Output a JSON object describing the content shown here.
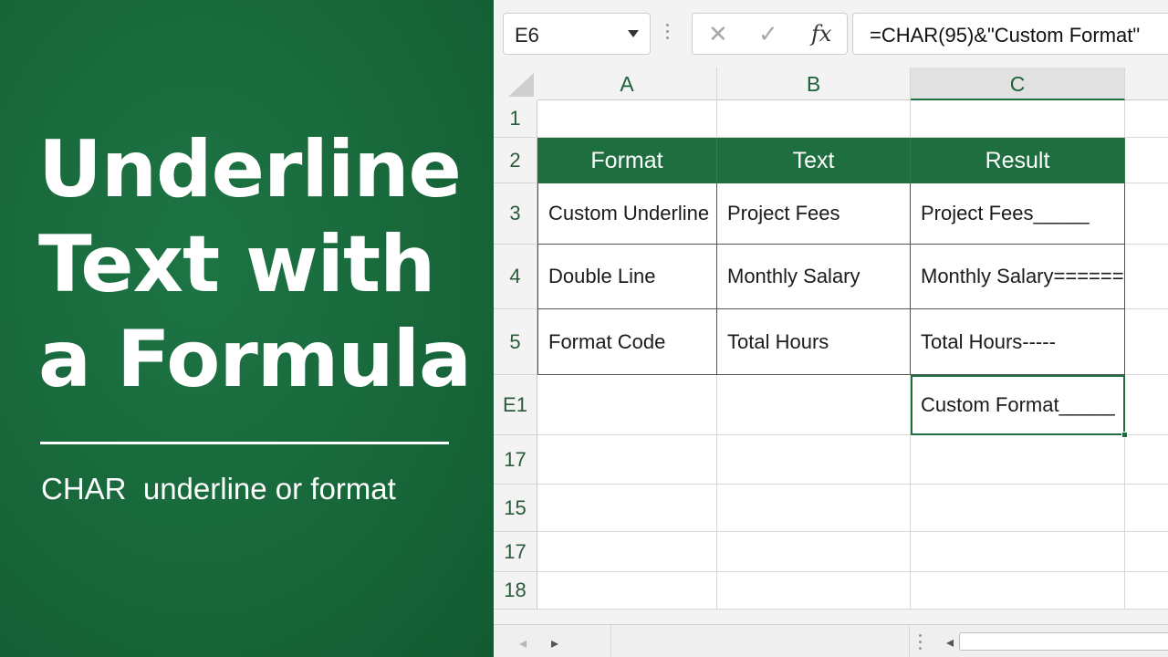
{
  "thumbnail": {
    "headline": [
      "Underline",
      "Text with",
      "a Formula"
    ],
    "subtitle": "CHAR  underline or format"
  },
  "formula_bar": {
    "name_box": "E6",
    "cancel_icon": "✕",
    "enter_icon": "✓",
    "fx_label": "fx",
    "formula": "=CHAR(95)&\"Custom Format\""
  },
  "columns": [
    "A",
    "B",
    "C"
  ],
  "active_column": "C",
  "rows": [
    {
      "label": "1",
      "cells": [
        "",
        "",
        ""
      ]
    },
    {
      "label": "2",
      "cells": [
        "Format",
        "Text",
        "Result"
      ]
    },
    {
      "label": "3",
      "cells": [
        "Custom Underline",
        "Project Fees",
        "Project Fees_____"
      ]
    },
    {
      "label": "4",
      "cells": [
        "Double Line",
        "Monthly Salary",
        "Monthly Salary======="
      ]
    },
    {
      "label": "5",
      "cells": [
        "Format Code",
        "Total Hours",
        "Total Hours-----"
      ]
    },
    {
      "label": "E1",
      "cells": [
        "",
        "",
        "Custom Format_____"
      ]
    },
    {
      "label": "17",
      "cells": [
        "",
        "",
        ""
      ]
    },
    {
      "label": "15",
      "cells": [
        "",
        "",
        ""
      ]
    },
    {
      "label": "17",
      "cells": [
        "",
        "",
        ""
      ]
    },
    {
      "label": "18",
      "cells": [
        "",
        "",
        ""
      ]
    }
  ],
  "colors": {
    "brand_green": "#186c3e",
    "header_green": "#1e6e3f"
  },
  "bottom_bar": {
    "prev_icon": "◂",
    "next_icon": "▸",
    "scroll_left_icon": "◂"
  }
}
